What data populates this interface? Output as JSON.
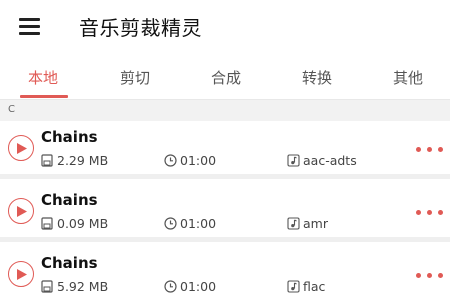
{
  "app": {
    "title": "音乐剪裁精灵"
  },
  "tabs": [
    {
      "label": "本地",
      "active": true
    },
    {
      "label": "剪切",
      "active": false
    },
    {
      "label": "合成",
      "active": false
    },
    {
      "label": "转换",
      "active": false
    },
    {
      "label": "其他",
      "active": false
    }
  ],
  "section": {
    "letter": "C"
  },
  "songs": [
    {
      "title": "Chains",
      "size": "2.29 MB",
      "duration": "01:00",
      "format": "aac-adts"
    },
    {
      "title": "Chains",
      "size": "0.09 MB",
      "duration": "01:00",
      "format": "amr"
    },
    {
      "title": "Chains",
      "size": "5.92 MB",
      "duration": "01:00",
      "format": "flac"
    }
  ],
  "colors": {
    "accent": "#e05a55",
    "section_bg": "#f2f2f2",
    "separator": "#efefef"
  },
  "icons": {
    "menu": "hamburger-menu-icon",
    "play": "play-icon",
    "size": "save-icon",
    "duration": "clock-icon",
    "format": "music-note-icon",
    "more": "more-dots-icon"
  }
}
